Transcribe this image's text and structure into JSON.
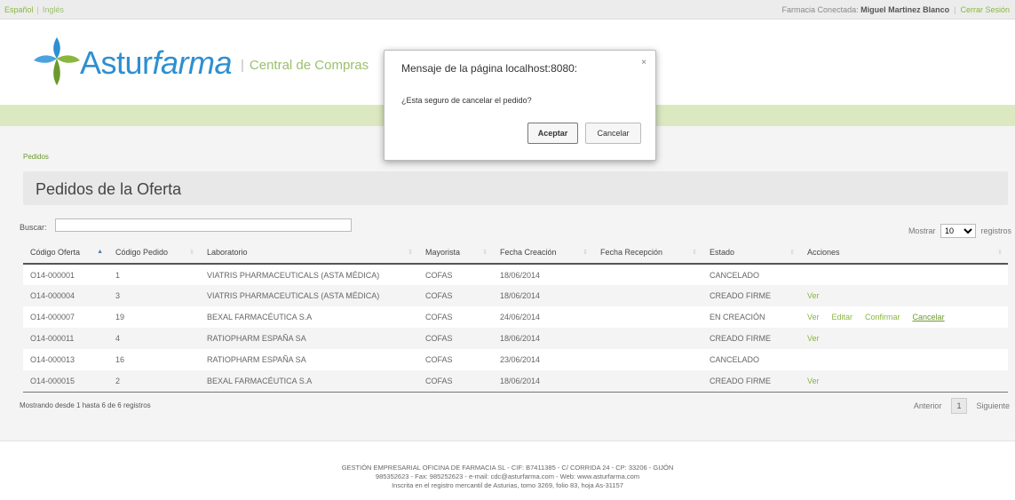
{
  "topbar": {
    "lang_active": "Español",
    "lang_other": "Inglés",
    "session_prefix": "Farmacia Conectada:",
    "user": "Miguel Martinez Blanco",
    "logout": "Cerrar Sesión"
  },
  "header": {
    "brand_a": "Astur",
    "brand_b": "farma",
    "tagline": "Central de Compras"
  },
  "breadcrumb": "Pedidos",
  "page_title": "Pedidos de la Oferta",
  "search": {
    "label": "Buscar:",
    "value": ""
  },
  "show": {
    "prefix": "Mostrar",
    "value": "10",
    "suffix": "registros"
  },
  "table": {
    "columns": [
      "Código Oferta",
      "Código Pedido",
      "Laboratorio",
      "Mayorista",
      "Fecha Creación",
      "Fecha Recepción",
      "Estado",
      "Acciones"
    ],
    "rows": [
      {
        "oferta": "O14-000001",
        "pedido": "1",
        "lab": "VIATRIS PHARMACEUTICALS (ASTA MÉDICA)",
        "mayorista": "COFAS",
        "creacion": "18/06/2014",
        "recepcion": "",
        "estado": "CANCELADO",
        "acciones": []
      },
      {
        "oferta": "O14-000004",
        "pedido": "3",
        "lab": "VIATRIS PHARMACEUTICALS (ASTA MÉDICA)",
        "mayorista": "COFAS",
        "creacion": "18/06/2014",
        "recepcion": "",
        "estado": "CREADO FIRME",
        "acciones": [
          "Ver"
        ]
      },
      {
        "oferta": "O14-000007",
        "pedido": "19",
        "lab": "BEXAL FARMACÉUTICA S.A",
        "mayorista": "COFAS",
        "creacion": "24/06/2014",
        "recepcion": "",
        "estado": "EN CREACIÓN",
        "acciones": [
          "Ver",
          "Editar",
          "Confirmar",
          "Cancelar"
        ]
      },
      {
        "oferta": "O14-000011",
        "pedido": "4",
        "lab": "RATIOPHARM ESPAÑA SA",
        "mayorista": "COFAS",
        "creacion": "18/06/2014",
        "recepcion": "",
        "estado": "CREADO FIRME",
        "acciones": [
          "Ver"
        ]
      },
      {
        "oferta": "O14-000013",
        "pedido": "16",
        "lab": "RATIOPHARM ESPAÑA SA",
        "mayorista": "COFAS",
        "creacion": "23/06/2014",
        "recepcion": "",
        "estado": "CANCELADO",
        "acciones": []
      },
      {
        "oferta": "O14-000015",
        "pedido": "2",
        "lab": "BEXAL FARMACÉUTICA S.A",
        "mayorista": "COFAS",
        "creacion": "18/06/2014",
        "recepcion": "",
        "estado": "CREADO FIRME",
        "acciones": [
          "Ver"
        ]
      }
    ]
  },
  "info": "Mostrando desde 1 hasta 6 de 6 registros",
  "pager": {
    "prev": "Anterior",
    "page": "1",
    "next": "Siguiente"
  },
  "footer": {
    "line1": "GESTIÓN EMPRESARIAL OFICINA DE FARMACIA SL - CIF: B7411385 - C/ CORRIDA 24 - CP: 33206 - GIJÓN",
    "line2": "985352623 - Fax: 985252623 - e-mail: cdc@asturfarma.com - Web: www.asturfarma.com",
    "line3": "Inscrita en el registro mercantil de Asturias, tomo 3269, folio 83, hoja As-31157"
  },
  "dialog": {
    "title": "Mensaje de la página localhost:8080:",
    "close": "×",
    "message": "¿Esta seguro de cancelar el pedido?",
    "ok": "Aceptar",
    "cancel": "Cancelar"
  },
  "colors": {
    "brand_blue": "#2e8fd1",
    "accent_green": "#8ab63f",
    "green_bar": "#dce9c0"
  }
}
